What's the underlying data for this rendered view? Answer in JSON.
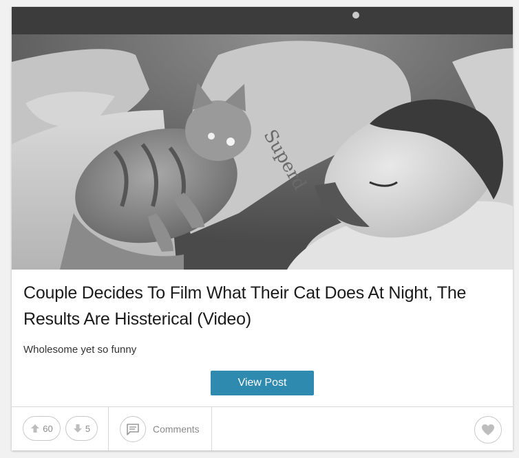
{
  "post": {
    "title": "Couple Decides To Film What Their Cat Does At Night, The Results Are Hissterical (Video)",
    "subtitle": "Wholesome yet so funny",
    "view_button": "View Post",
    "image_alt": "Night-vision image of a cat standing next to a sleeping man in bed",
    "shirt_text": "Superd"
  },
  "footer": {
    "upvotes": "60",
    "downvotes": "5",
    "comments_label": "Comments"
  },
  "colors": {
    "button": "#2f8ab0",
    "icon_gray": "#bdbdbd",
    "text_dark": "#1b1b1b"
  },
  "icons": [
    "arrow-up-icon",
    "arrow-down-icon",
    "comment-icon",
    "heart-icon"
  ]
}
